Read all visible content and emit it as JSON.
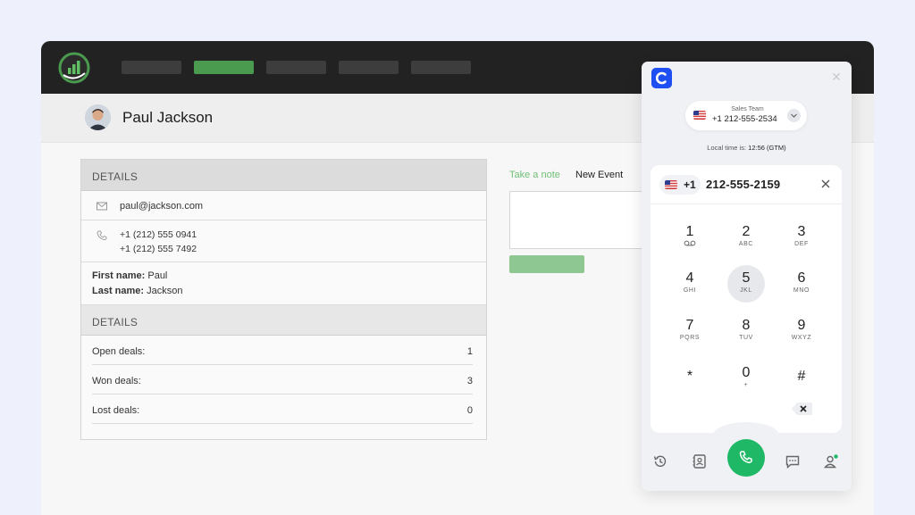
{
  "nav": {
    "items": [
      "",
      "",
      "",
      "",
      ""
    ],
    "active_index": 1
  },
  "contact": {
    "name": "Paul Jackson",
    "email": "paul@jackson.com",
    "phones": [
      "+1 (212) 555 0941",
      "+1 (212) 555 7492"
    ],
    "first_name_label": "First name:",
    "first_name": "Paul",
    "last_name_label": "Last name:",
    "last_name": "Jackson"
  },
  "details": {
    "heading": "DETAILS",
    "deals_heading": "DETAILS",
    "stats": [
      {
        "label": "Open deals:",
        "value": "1"
      },
      {
        "label": "Won deals:",
        "value": "3"
      },
      {
        "label": "Lost deals:",
        "value": "0"
      }
    ]
  },
  "notes": {
    "tab_note": "Take a note",
    "tab_event": "New Event"
  },
  "dialer": {
    "line_team": "Sales Team",
    "line_number": "+1 212-555-2534",
    "local_time_label": "Local time is:",
    "local_time_value": "12:56 (GTM)",
    "country_code": "+1",
    "dialed_number": "212-555-2159",
    "pressed_key": "5",
    "keys": [
      {
        "digit": "1",
        "letters": "voicemail-icon"
      },
      {
        "digit": "2",
        "letters": "ABC"
      },
      {
        "digit": "3",
        "letters": "DEF"
      },
      {
        "digit": "4",
        "letters": "GHI"
      },
      {
        "digit": "5",
        "letters": "JKL"
      },
      {
        "digit": "6",
        "letters": "MNO"
      },
      {
        "digit": "7",
        "letters": "PQRS"
      },
      {
        "digit": "8",
        "letters": "TUV"
      },
      {
        "digit": "9",
        "letters": "WXYZ"
      },
      {
        "digit": "*",
        "letters": ""
      },
      {
        "digit": "0",
        "letters": "+"
      },
      {
        "digit": "#",
        "letters": ""
      }
    ],
    "bottom_icons": [
      "history-icon",
      "contacts-icon",
      "call-icon",
      "chat-icon",
      "user-status-icon"
    ]
  },
  "colors": {
    "accent_green": "#4a9a4f",
    "call_green": "#1fb866",
    "brand_blue": "#1f4ff2",
    "topbar": "#222222"
  }
}
